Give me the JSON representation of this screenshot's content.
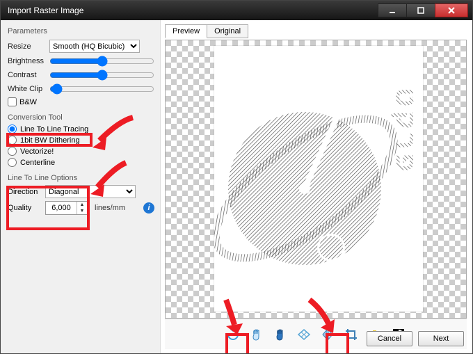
{
  "titlebar": {
    "title": "Import Raster Image"
  },
  "params": {
    "heading": "Parameters",
    "resize_label": "Resize",
    "resize_value": "Smooth (HQ Bicubic)",
    "brightness_label": "Brightness",
    "contrast_label": "Contrast",
    "whiteclip_label": "White Clip",
    "bw_label": "B&W"
  },
  "conv": {
    "heading": "Conversion Tool",
    "opt_line2line": "Line To Line Tracing",
    "opt_dither": "1bit BW Dithering",
    "opt_vectorize": "Vectorize!",
    "opt_centerline": "Centerline",
    "selected": "line2line"
  },
  "opts": {
    "heading": "Line To Line Options",
    "direction_label": "Direction",
    "direction_value": "Diagonal",
    "quality_label": "Quality",
    "quality_value": "6,000",
    "quality_unit": "lines/mm"
  },
  "tabs": {
    "preview": "Preview",
    "original": "Original",
    "active": "preview"
  },
  "toolbar": {
    "rotate_ccw": "rotate-ccw",
    "pan": "pan",
    "zoom_fit": "zoom-fit",
    "diamond": "grid",
    "flip_h": "flip-horizontal",
    "crop": "crop",
    "colors": "colors",
    "invert": "invert"
  },
  "footer": {
    "cancel": "Cancel",
    "next": "Next"
  },
  "annotations": {
    "color": "#ed1c24"
  }
}
